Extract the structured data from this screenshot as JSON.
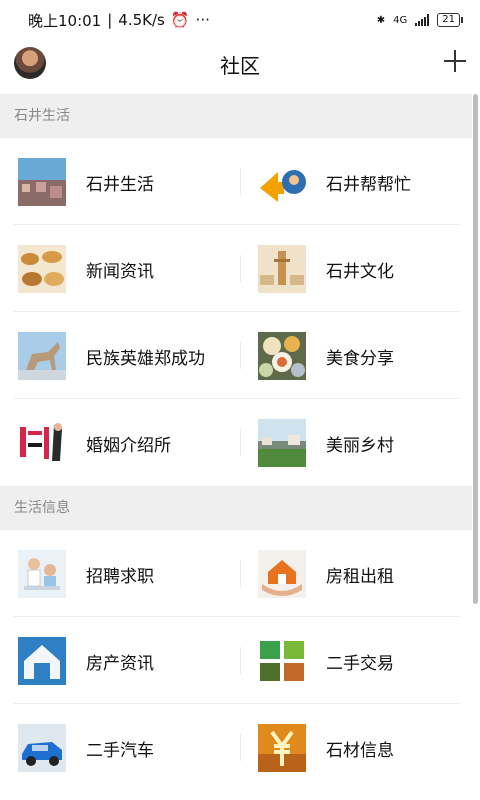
{
  "status_bar": {
    "time": "晚上10:01",
    "speed": "4.5K/s",
    "network": "4G",
    "battery": "21"
  },
  "header": {
    "title": "社区",
    "avatar_icon": "user-avatar",
    "add_icon": "plus-icon"
  },
  "sections": [
    {
      "title": "石井生活",
      "items": [
        {
          "label": "石井生活"
        },
        {
          "label": "石井帮帮忙"
        },
        {
          "label": "新闻资讯"
        },
        {
          "label": "石井文化"
        },
        {
          "label": "民族英雄郑成功"
        },
        {
          "label": "美食分享"
        },
        {
          "label": "婚姻介绍所"
        },
        {
          "label": "美丽乡村"
        }
      ]
    },
    {
      "title": "生活信息",
      "items": [
        {
          "label": "招聘求职"
        },
        {
          "label": "房租出租"
        },
        {
          "label": "房产资讯"
        },
        {
          "label": "二手交易"
        },
        {
          "label": "二手汽车"
        },
        {
          "label": "石材信息"
        }
      ]
    }
  ]
}
